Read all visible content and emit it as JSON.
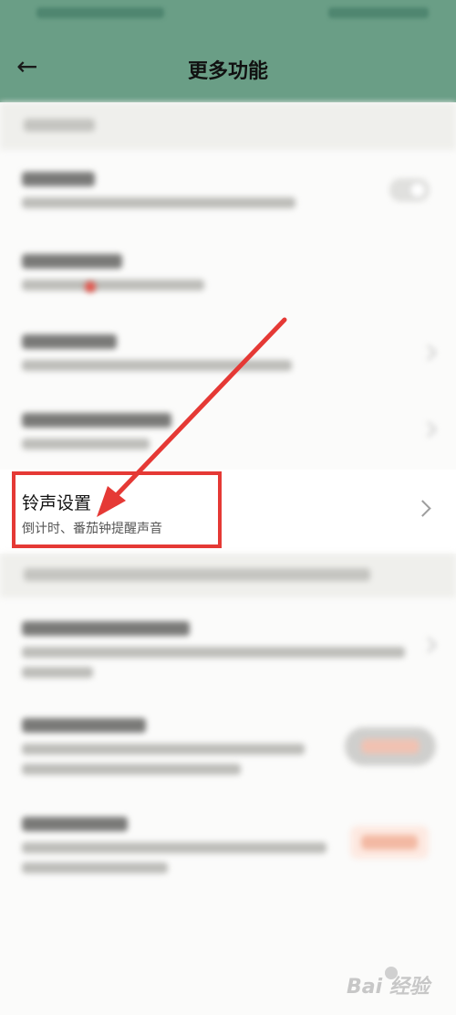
{
  "header": {
    "title": "更多功能",
    "back_icon": "arrow-left-icon"
  },
  "highlighted_item": {
    "title": "铃声设置",
    "subtitle": "倒计时、番茄钟提醒声音"
  },
  "colors": {
    "header_bg": "#6a9e86",
    "annotation_red": "#e53935"
  },
  "watermark": {
    "text": "Bai 经验"
  }
}
